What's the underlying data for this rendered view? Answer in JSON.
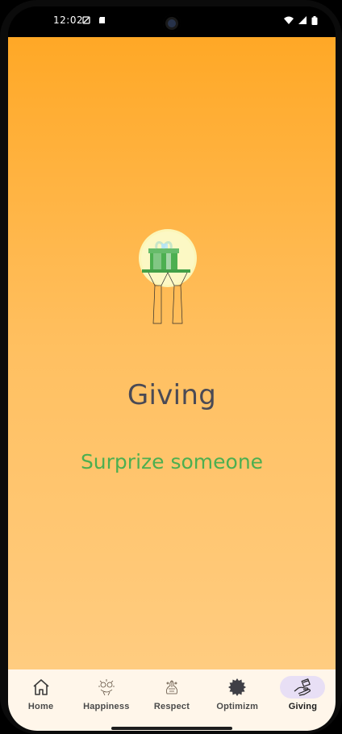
{
  "status_bar": {
    "time": "12:02"
  },
  "page": {
    "title": "Giving",
    "subtitle": "Surprize someone"
  },
  "nav": {
    "items": [
      {
        "label": "Home",
        "icon": "home-icon"
      },
      {
        "label": "Happiness",
        "icon": "happiness-icon"
      },
      {
        "label": "Respect",
        "icon": "respect-icon"
      },
      {
        "label": "Optimizm",
        "icon": "optimizm-icon"
      },
      {
        "label": "Giving",
        "icon": "giving-icon"
      }
    ],
    "active_index": 4
  },
  "colors": {
    "gradient_top": "#ffa826",
    "gradient_bottom": "#ffcc80",
    "title": "#4a4a55",
    "subtitle": "#4caf50",
    "active_pill": "#e8dff5"
  }
}
